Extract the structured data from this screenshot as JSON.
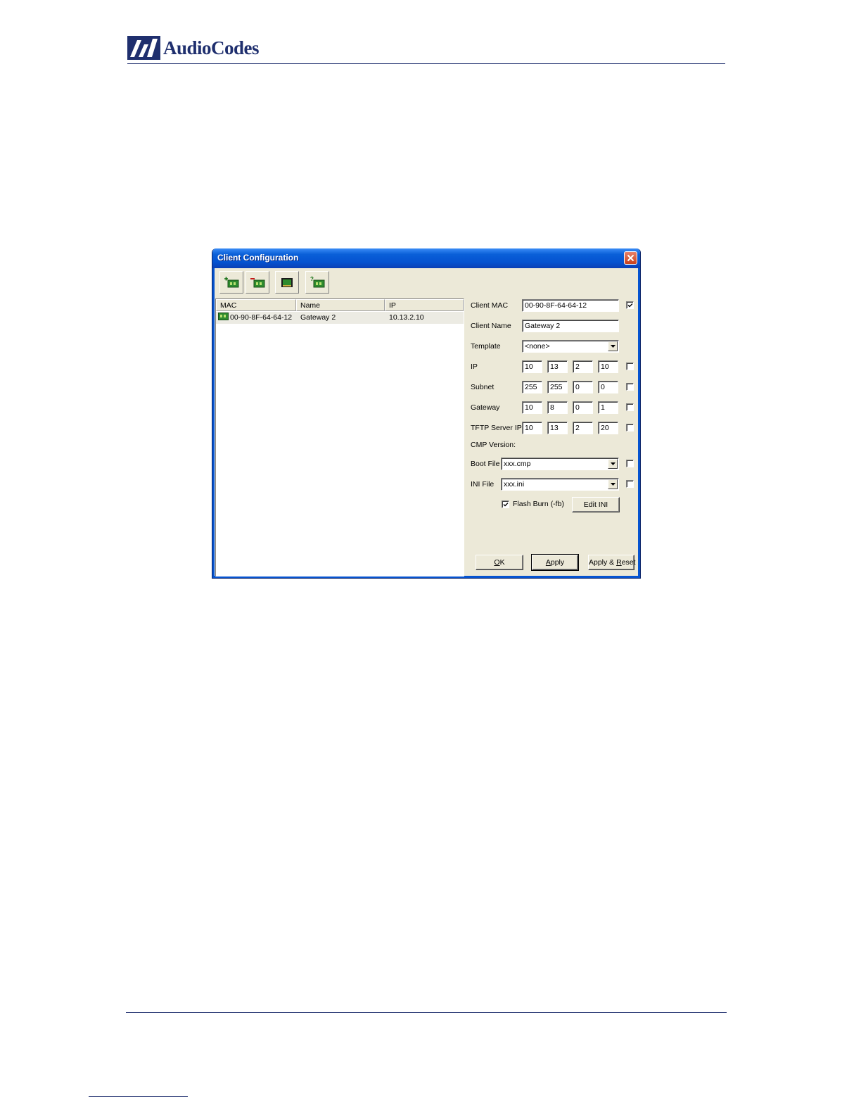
{
  "brand": {
    "name": "AudioCodes",
    "color": "#1f2f6e"
  },
  "dialog": {
    "title": "Client Configuration",
    "toolbar": [
      {
        "icon": "add-client-icon"
      },
      {
        "icon": "remove-client-icon"
      },
      {
        "icon": "folder-icon"
      },
      {
        "icon": "query-client-icon"
      }
    ],
    "list": {
      "columns": [
        "MAC",
        "Name",
        "IP"
      ],
      "rows": [
        {
          "mac": "00-90-8F-64-64-12",
          "name": "Gateway 2",
          "ip": "10.13.2.10"
        }
      ]
    },
    "form": {
      "client_mac_label": "Client MAC",
      "client_mac_value": "00-90-8F-64-64-12",
      "client_mac_checked": true,
      "client_name_label": "Client Name",
      "client_name_value": "Gateway 2",
      "template_label": "Template",
      "template_value": "<none>",
      "ip_label": "IP",
      "ip_octets": [
        "10",
        "13",
        "2",
        "10"
      ],
      "subnet_label": "Subnet",
      "subnet_octets": [
        "255",
        "255",
        "0",
        "0"
      ],
      "gateway_label": "Gateway",
      "gateway_octets": [
        "10",
        "8",
        "0",
        "1"
      ],
      "tftp_label": "TFTP Server IP",
      "tftp_octets": [
        "10",
        "13",
        "2",
        "20"
      ],
      "cmp_version_label": "CMP Version:",
      "boot_file_label": "Boot File",
      "boot_file_value": "xxx.cmp",
      "ini_file_label": "INI File",
      "ini_file_value": "xxx.ini",
      "flash_burn_label": "Flash Burn (-fb)",
      "flash_burn_checked": true,
      "edit_ini_label": "Edit INI"
    },
    "buttons": {
      "ok_mnemonic": "O",
      "ok_rest": "K",
      "apply_mnemonic": "A",
      "apply_rest": "pply",
      "apply_reset_prefix": "Apply & ",
      "apply_reset_mnemonic": "R",
      "apply_reset_rest": "eset"
    }
  }
}
